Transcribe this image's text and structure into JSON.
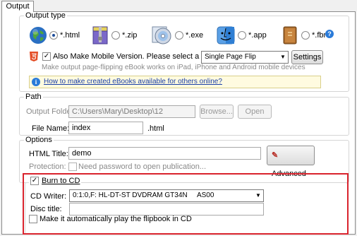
{
  "tabs": [
    {
      "label": "Output"
    }
  ],
  "output_type": {
    "legend": "Output type",
    "options": [
      {
        "label": "*.html",
        "icon": "globe-icon",
        "selected": true
      },
      {
        "label": "*.zip",
        "icon": "zip-archive-icon",
        "selected": false
      },
      {
        "label": "*.exe",
        "icon": "cd-disc-icon",
        "selected": false
      },
      {
        "label": "*.app",
        "icon": "mac-finder-icon",
        "selected": false
      },
      {
        "label": "*.fbr",
        "icon": "book-icon",
        "selected": false
      }
    ],
    "help_icon": "?",
    "mobile": {
      "checked": true,
      "label": "Also Make Mobile Version. Please select a template for mobile:",
      "template": "Single Page Flip",
      "settings_label": "Settings",
      "note": "Make output page-flipping eBook works on iPad, iPhone and Android mobile devices"
    },
    "info_link": "How to make created eBooks available for others online?"
  },
  "path": {
    "legend": "Path",
    "output_folder_label": "Output Folder:",
    "output_folder_value": "C:\\Users\\Mary\\Desktop\\12",
    "browse_label": "Browse...",
    "open_label": "Open",
    "file_name_label": "File Name:",
    "file_name_value": "index",
    "file_ext": ".html"
  },
  "options": {
    "legend": "Options",
    "html_title_label": "HTML Title:",
    "html_title_value": "demo",
    "advanced_label": "Advanced",
    "protection_label": "Protection:",
    "password_label": "Need password to open publication..."
  },
  "burn": {
    "checked": true,
    "label": "Burn to CD",
    "cd_writer_label": "CD Writer:",
    "cd_writer_value": "0:1:0,F: HL-DT-ST DVDRAM GT34N     AS00",
    "disc_title_label": "Disc title:",
    "disc_title_value": "",
    "autoplay_label": "Make it automatically play the flipbook in CD"
  },
  "colors": {
    "highlight": "#d9232d",
    "link": "#1a3fa8",
    "info_bg": "#fffbe0"
  }
}
